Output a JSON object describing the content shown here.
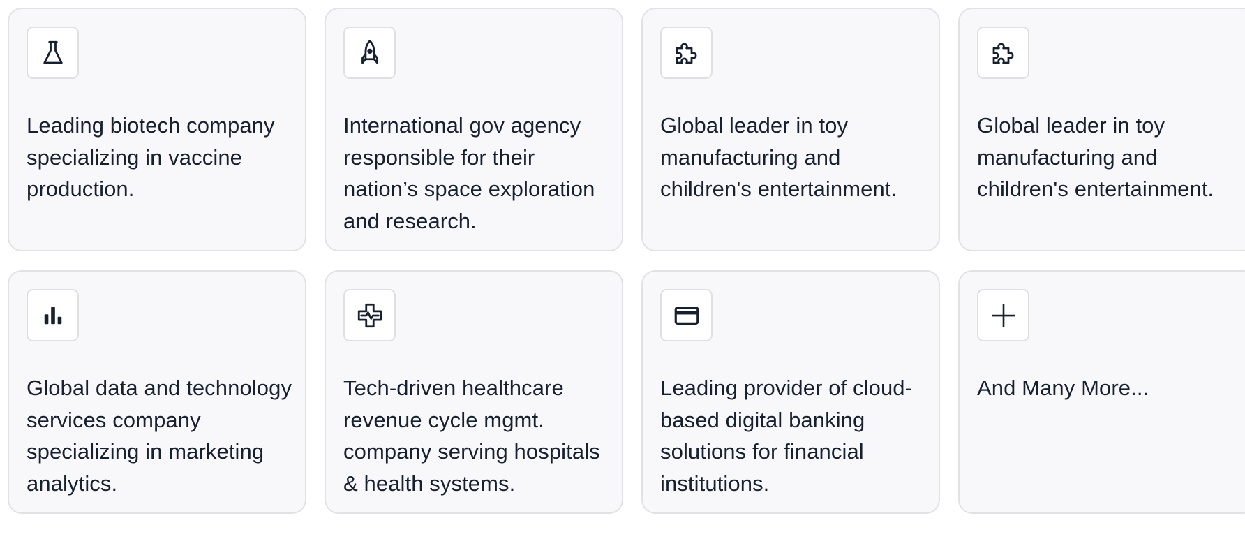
{
  "cards": [
    {
      "icon": "flask-icon",
      "text": "Leading biotech company specializing in vaccine production."
    },
    {
      "icon": "rocket-icon",
      "text": "International gov agency responsible for their nation’s space exploration and research."
    },
    {
      "icon": "puzzle-icon",
      "text": "Global leader in toy manufacturing and children's entertainment."
    },
    {
      "icon": "puzzle-icon",
      "text": "Global leader in toy manufacturing and children's entertainment."
    },
    {
      "icon": "bar-chart-icon",
      "text": "Global data and technology services company specializing in marketing analytics."
    },
    {
      "icon": "medical-cross-icon",
      "text": "Tech-driven healthcare revenue cycle mgmt. company serving hospitals & health systems."
    },
    {
      "icon": "credit-card-icon",
      "text": "Leading provider of cloud-based digital banking solutions for financial institutions."
    },
    {
      "icon": "plus-icon",
      "text": "And Many More..."
    }
  ],
  "colors": {
    "card_background": "#f8f8fa",
    "card_border": "#e1e2e6",
    "text": "#16202f"
  }
}
